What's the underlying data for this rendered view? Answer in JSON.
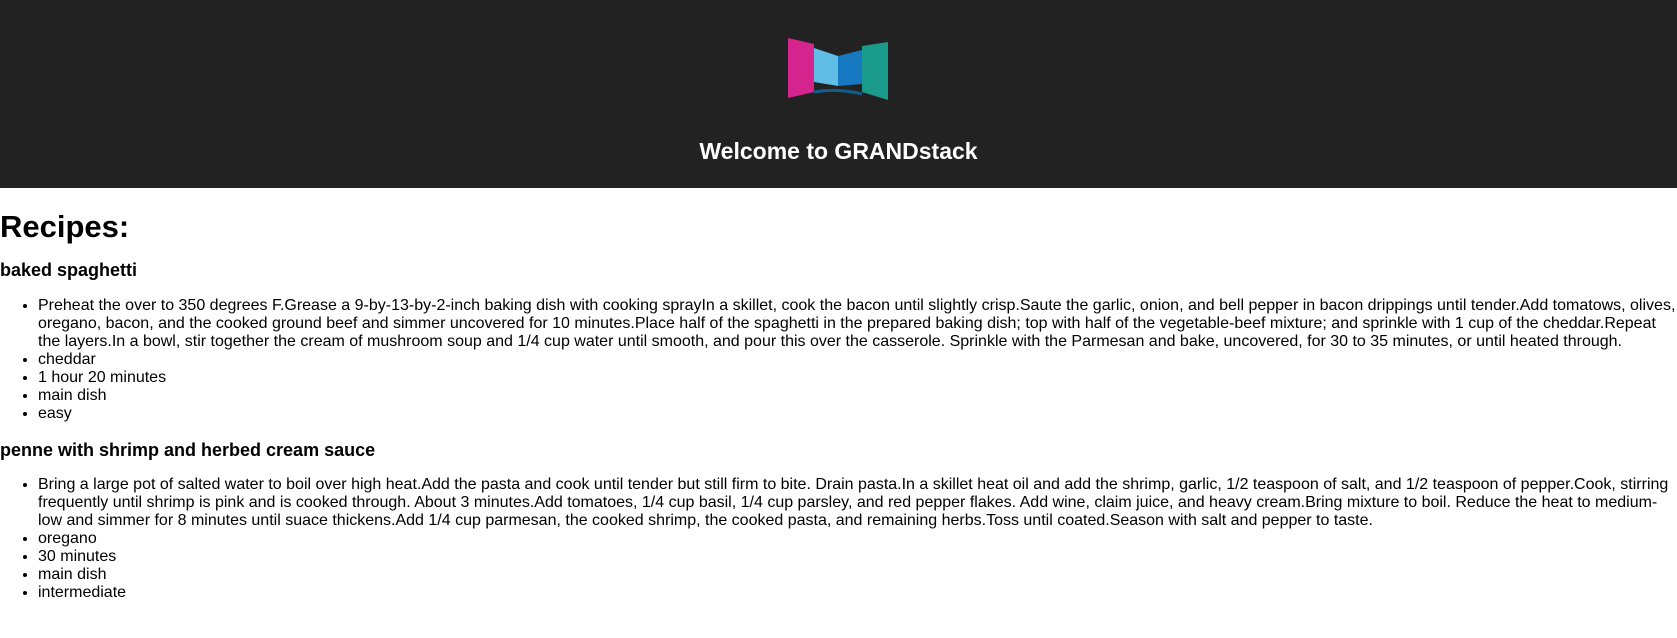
{
  "header": {
    "title": "Welcome to GRANDstack",
    "logo_colors": {
      "magenta": "#d6248f",
      "light_blue": "#5fbde6",
      "blue": "#1778c2",
      "teal": "#1a9a8a"
    }
  },
  "main": {
    "section_title": "Recipes:",
    "recipes": [
      {
        "name": "baked spaghetti",
        "instructions": "Preheat the over to 350 degrees F.Grease a 9-by-13-by-2-inch baking dish with cooking sprayIn a skillet, cook the bacon until slightly crisp.Saute the garlic, onion, and bell pepper in bacon drippings until tender.Add tomatows, olives, oregano, bacon, and the cooked ground beef and simmer uncovered for 10 minutes.Place half of the spaghetti in the prepared baking dish; top with half of the vegetable-beef mixture; and sprinkle with 1 cup of the cheddar.Repeat the layers.In a bowl, stir together the cream of mushroom soup and 1/4 cup water until smooth, and pour this over the casserole. Sprinkle with the Parmesan and bake, uncovered, for 30 to 35 minutes, or until heated through.",
        "ingredient": "cheddar",
        "time": "1 hour 20 minutes",
        "category": "main dish",
        "difficulty": "easy"
      },
      {
        "name": "penne with shrimp and herbed cream sauce",
        "instructions": "Bring a large pot of salted water to boil over high heat.Add the pasta and cook until tender but still firm to bite. Drain pasta.In a skillet heat oil and add the shrimp, garlic, 1/2 teaspoon of salt, and 1/2 teaspoon of pepper.Cook, stirring frequently until shrimp is pink and is cooked through. About 3 minutes.Add tomatoes, 1/4 cup basil, 1/4 cup parsley, and red pepper flakes. Add wine, claim juice, and heavy cream.Bring mixture to boil. Reduce the heat to medium-low and simmer for 8 minutes until suace thickens.Add 1/4 cup parmesan, the cooked shrimp, the cooked pasta, and remaining herbs.Toss until coated.Season with salt and pepper to taste.",
        "ingredient": "oregano",
        "time": "30 minutes",
        "category": "main dish",
        "difficulty": "intermediate"
      }
    ]
  }
}
